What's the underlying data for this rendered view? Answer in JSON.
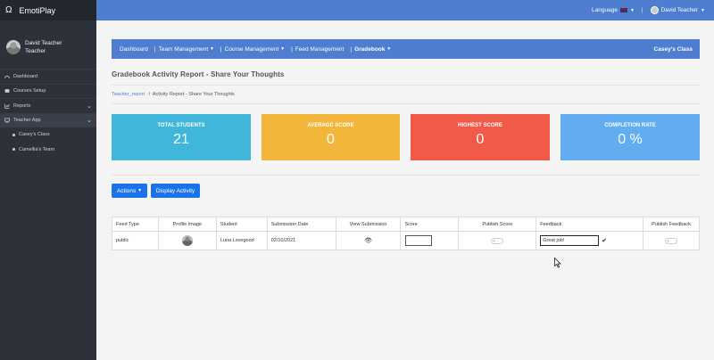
{
  "app": {
    "brand": "EmotiPlay"
  },
  "sidebar": {
    "user_name": "David Teacher",
    "user_role": "Teacher",
    "items": [
      {
        "label": "Dashboard",
        "icon": "dashboard-icon"
      },
      {
        "label": "Courses Setup",
        "icon": "book-icon"
      },
      {
        "label": "Reports",
        "icon": "chart-icon"
      },
      {
        "label": "Teacher App",
        "icon": "monitor-icon"
      }
    ],
    "sub_items": [
      {
        "label": "Casey's Class"
      },
      {
        "label": "Camellia's Team"
      }
    ]
  },
  "topbar": {
    "language": "Language",
    "user": "David Teacher"
  },
  "mainnav": {
    "items": [
      "Dashboard",
      "Team Management",
      "Course Management",
      "Feed Management",
      "Gradebook"
    ],
    "class_name": "Casey's Class"
  },
  "page": {
    "title": "Gradebook Activity Report - Share Your Thoughts",
    "breadcrumb_link": "Teacher_report",
    "breadcrumb_current": "Activity Report - Share Your Thoughts"
  },
  "stats": [
    {
      "label": "TOTAL STUDENTS",
      "value": "21",
      "color": "#3fb6da"
    },
    {
      "label": "AVERAGE SCORE",
      "value": "0",
      "color": "#f2b63b"
    },
    {
      "label": "HIGHEST SCORE",
      "value": "0",
      "color": "#f15a48"
    },
    {
      "label": "COMPLETION RATE",
      "value": "0 %",
      "color": "#61adf0"
    }
  ],
  "buttons": {
    "actions": "Actions",
    "display_activity": "Display Activity"
  },
  "table": {
    "headers": [
      "Feed Type",
      "Profile Image",
      "Student",
      "Submission Date",
      "View Submission",
      "Score",
      "Publish Score",
      "Feedback",
      "Publish Feedback"
    ],
    "rows": [
      {
        "feed_type": "public",
        "student": "Luna Lovegood",
        "date": "02/10/2021",
        "feedback": "Great job!"
      }
    ]
  }
}
